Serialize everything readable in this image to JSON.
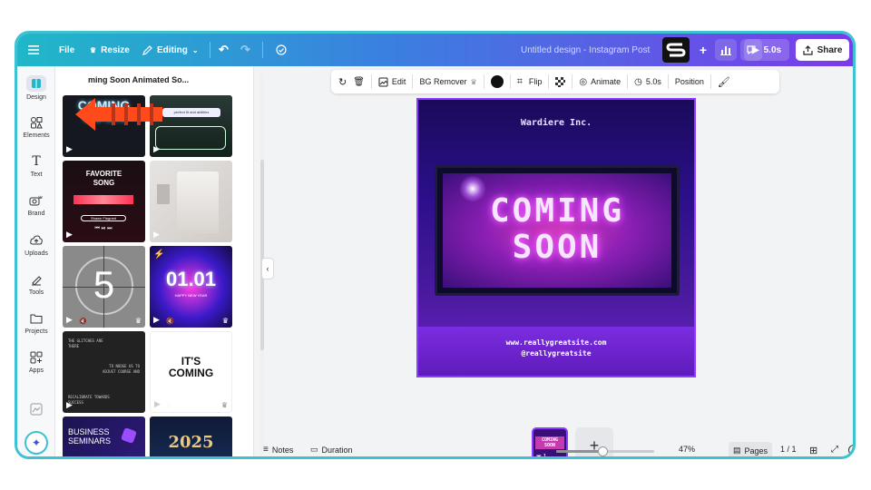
{
  "topbar": {
    "menu_icon": "hamburger-icon",
    "file_label": "File",
    "resize_label": "Resize",
    "editing_label": "Editing",
    "design_title": "Untitled design - Instagram Post",
    "play_label": "5.0s",
    "share_label": "Share"
  },
  "sidebar": {
    "items": [
      {
        "label": "Design",
        "icon": "design-icon"
      },
      {
        "label": "Elements",
        "icon": "elements-icon"
      },
      {
        "label": "Text",
        "icon": "text-icon"
      },
      {
        "label": "Brand",
        "icon": "brand-icon"
      },
      {
        "label": "Uploads",
        "icon": "uploads-icon"
      },
      {
        "label": "Tools",
        "icon": "tools-icon"
      },
      {
        "label": "Projects",
        "icon": "projects-icon"
      },
      {
        "label": "Apps",
        "icon": "apps-icon"
      }
    ]
  },
  "panel": {
    "title": "ming Soon Animated So...",
    "tiles": {
      "t1": {
        "line1": "COMING",
        "line2": "SOON"
      },
      "t2": {
        "caption": "perfect fit and abilities"
      },
      "t3": {
        "line1": "FAVORITE",
        "line2": "SONG",
        "sub": "Shawn Flagrant"
      },
      "t5": {
        "number": "5"
      },
      "t6": {
        "number": "01.01",
        "sub": "HAPPY NEW YEAR"
      },
      "t7": {
        "line1": "THE GLITCHES ARE",
        "line2": "THERE",
        "line3": "TO NUDGE US TO",
        "line4": "ADJUST COURSE AND",
        "line5": "RECALIBRATE TOWARDS",
        "line6": "SUCCESS"
      },
      "t8": {
        "line1": "IT'S",
        "line2": "COMING"
      },
      "t9": {
        "line1": "BUSINESS",
        "line2": "SEMINARS"
      },
      "t10": {
        "number": "2025"
      }
    }
  },
  "toolbar": {
    "edit_label": "Edit",
    "bg_remover_label": "BG Remover",
    "color_value": "#111111",
    "flip_label": "Flip",
    "animate_label": "Animate",
    "duration_label": "5.0s",
    "position_label": "Position"
  },
  "design": {
    "company": "Wardiere Inc.",
    "title_line1": "COMING",
    "title_line2": "SOON",
    "url": "www.reallygreatsite.com",
    "handle": "@reallygreatsite"
  },
  "pages": {
    "thumb_line1": "COMING",
    "thumb_line2": "SOON",
    "thumb_number": "1",
    "add_label": "+"
  },
  "bottombar": {
    "notes_label": "Notes",
    "duration_label": "Duration",
    "zoom_percent": "47%",
    "zoom_level": 47,
    "pages_label": "Pages",
    "page_count": "1 / 1"
  },
  "colors": {
    "accent": "#8d3bff",
    "frame_border": "#3ec1d3",
    "arrow": "#ff4a1c"
  }
}
